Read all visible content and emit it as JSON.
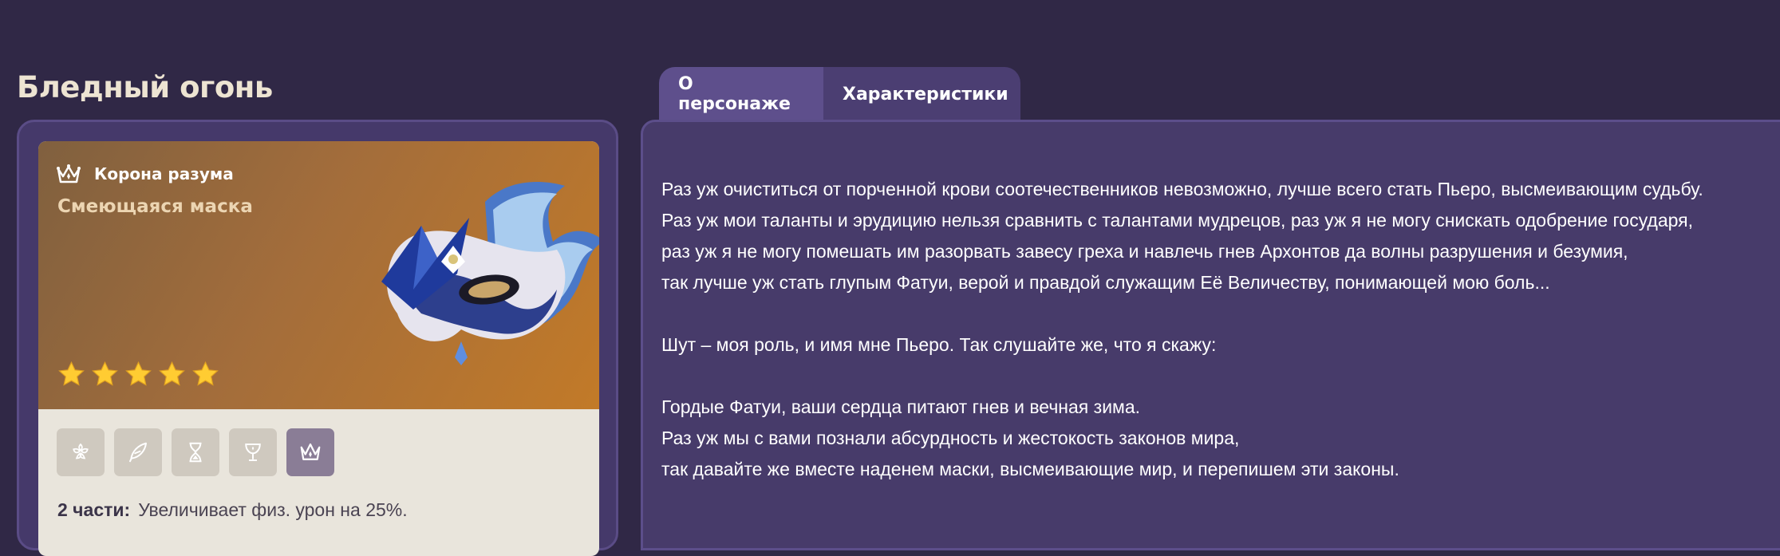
{
  "set": {
    "title": "Бледный огонь"
  },
  "item": {
    "slot_name": "Корона разума",
    "name": "Смеющаяся маска",
    "rarity": 5,
    "slot_icon": "crown-icon",
    "artwork": "masquerade-mask-image"
  },
  "pieces": [
    {
      "name": "flower-icon",
      "active": false
    },
    {
      "name": "feather-icon",
      "active": false
    },
    {
      "name": "hourglass-icon",
      "active": false
    },
    {
      "name": "goblet-icon",
      "active": false
    },
    {
      "name": "crown-icon",
      "active": true
    }
  ],
  "bonus": {
    "label": "2 части:",
    "text": "Увеличивает физ. урон на 25%."
  },
  "tabs": [
    {
      "label": "О персонаже",
      "active": true
    },
    {
      "label": "Характеристики",
      "active": false
    }
  ],
  "lore": {
    "p1": [
      "Раз уж очиститься от порченной крови соотечественников невозможно, лучше всего стать Пьеро, высмеивающим судьбу.",
      "Раз уж мои таланты и эрудицию нельзя сравнить с талантами мудрецов, раз уж я не могу снискать одобрение государя,",
      "раз уж я не могу помешать им разорвать завесу греха и навлечь гнев Архонтов да волны разрушения и безумия,",
      "так лучше уж стать глупым Фатуи, верой и правдой служащим Её Величеству, понимающей мою боль..."
    ],
    "p2": [
      "Шут – моя роль, и имя мне Пьеро. Так слушайте же, что я скажу:"
    ],
    "p3": [
      "Гордые Фатуи, ваши сердца питают гнев и вечная зима.",
      "Раз уж мы с вами познали абсурдность и жестокость законов мира,",
      "так давайте же вместе наденем маски, высмеивающие мир, и перепишем эти законы."
    ]
  },
  "colors": {
    "background": "#302846",
    "panel": "#473b6a",
    "card_gradient_start": "#80603f",
    "card_gradient_end": "#c27a28",
    "star": "#ffcc32",
    "title": "#ede4d2",
    "item_name": "#ecd5b2"
  }
}
